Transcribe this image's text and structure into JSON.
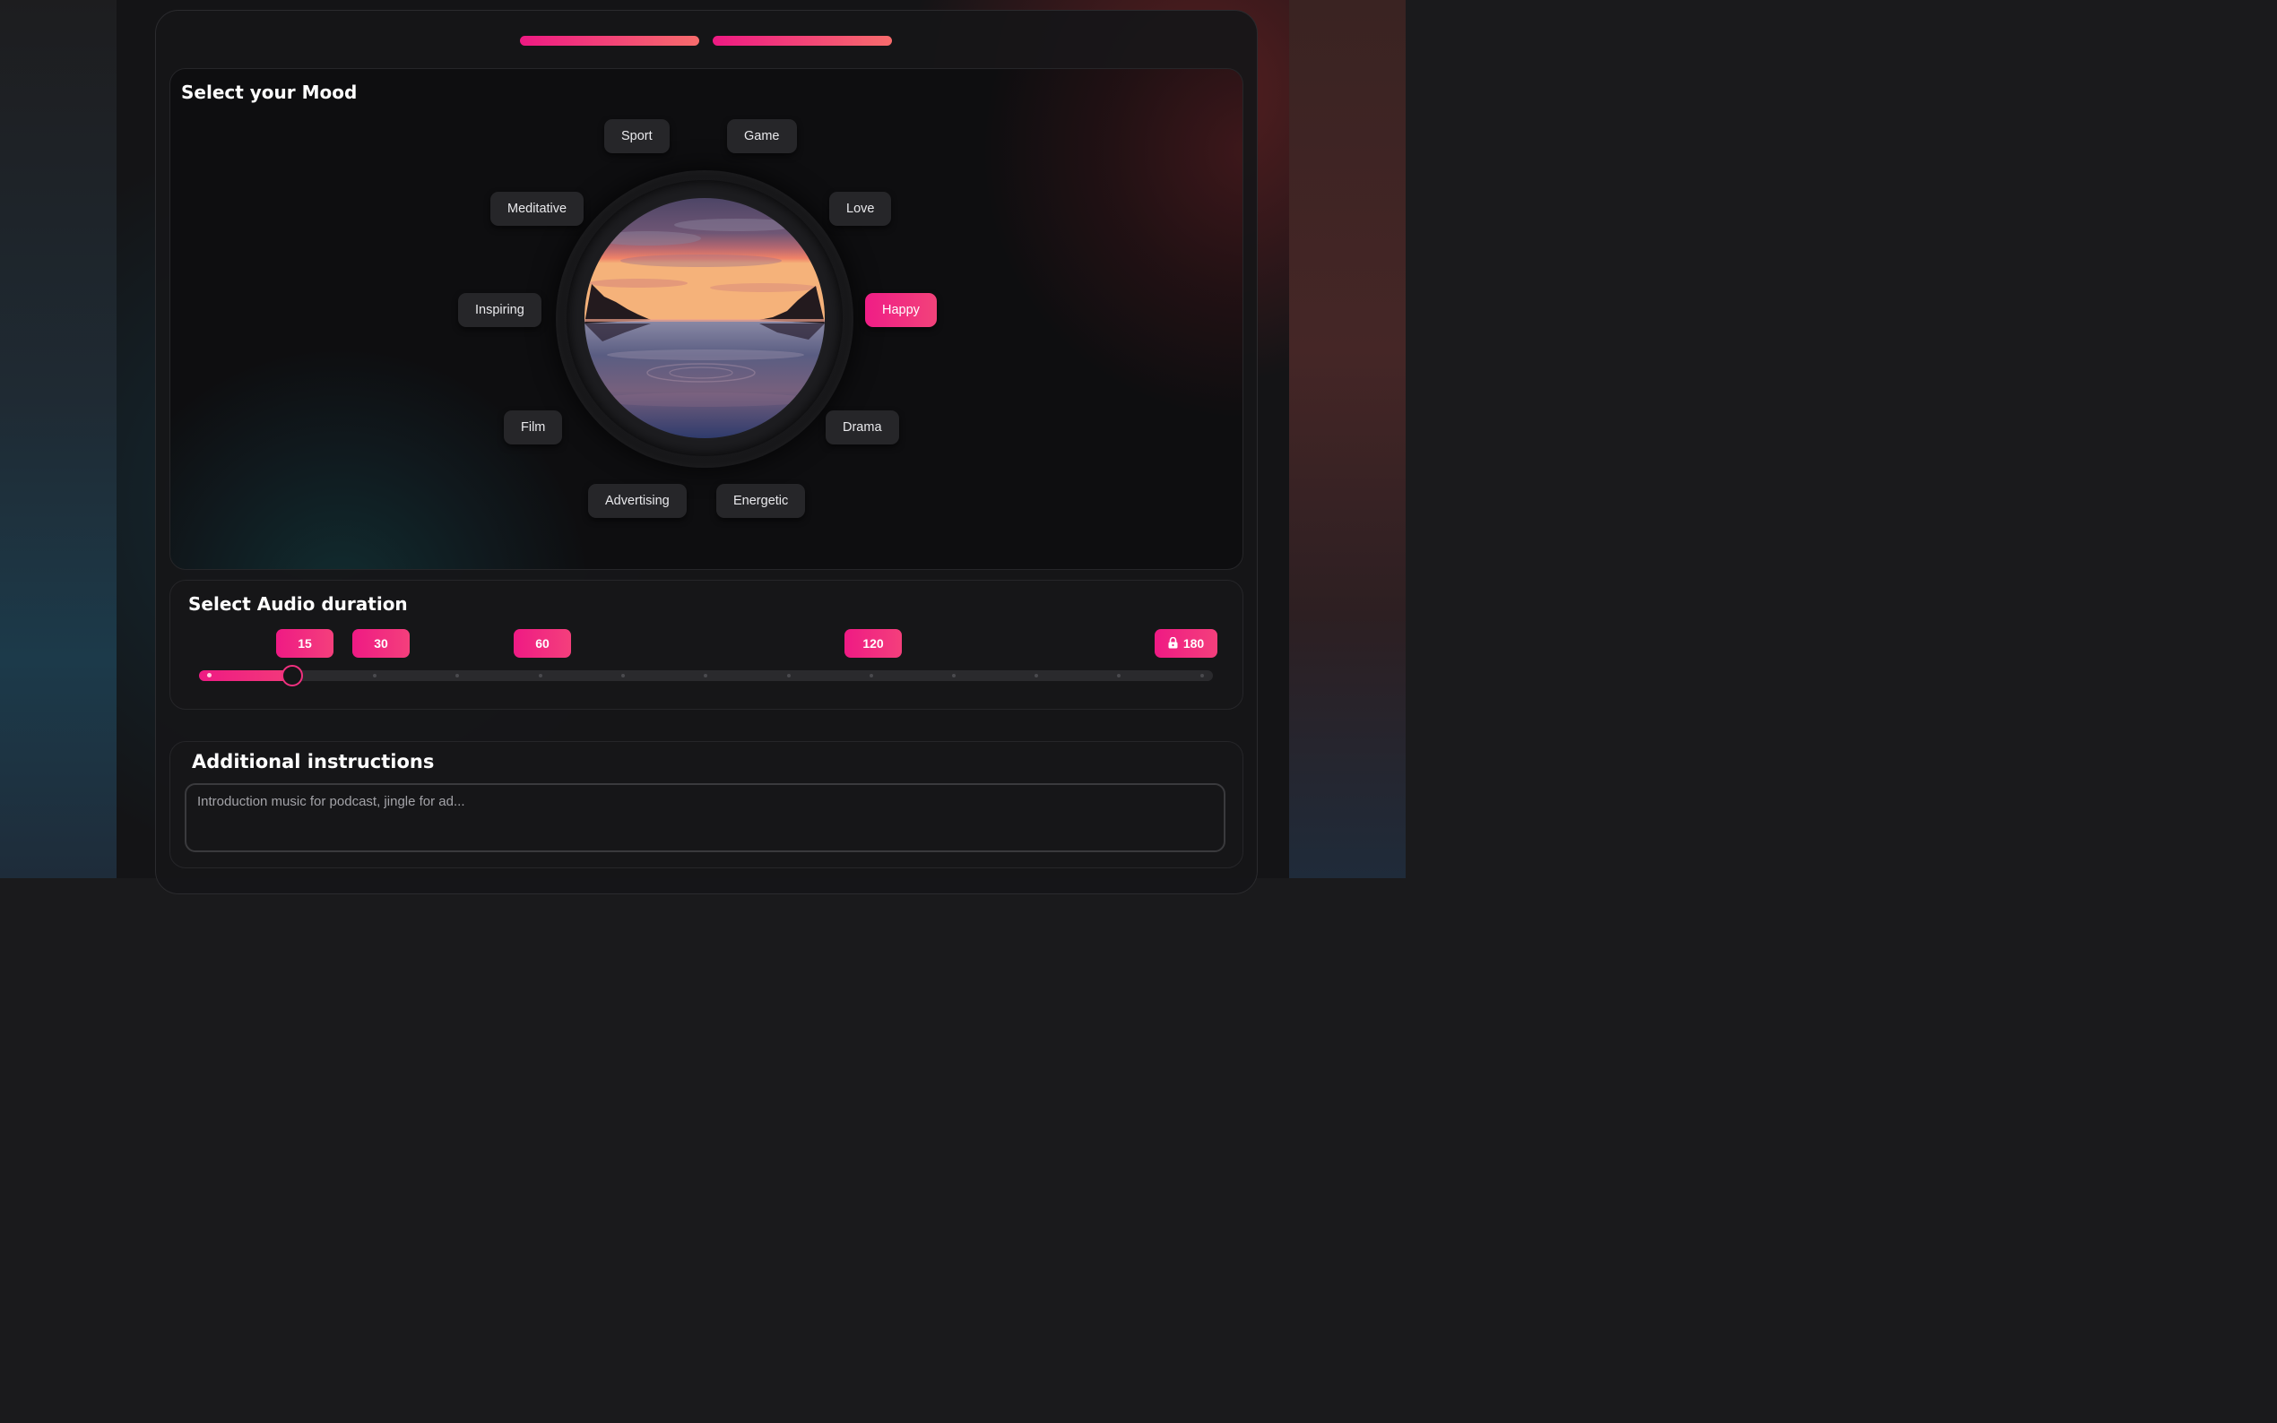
{
  "progress_steps": [
    {
      "status": "complete",
      "color": "#ee1a83"
    },
    {
      "status": "complete",
      "color": "#f76c6c"
    }
  ],
  "mood": {
    "title": "Select your Mood",
    "selected": "Happy",
    "options": [
      "Sport",
      "Game",
      "Meditative",
      "Love",
      "Inspiring",
      "Happy",
      "Film",
      "Drama",
      "Advertising",
      "Energetic"
    ]
  },
  "duration": {
    "title": "Select Audio duration",
    "markers": [
      "15",
      "30",
      "60",
      "120",
      "180"
    ],
    "locked": [
      "180"
    ],
    "lock_icon": "lock-icon",
    "selected_value": "15"
  },
  "instructions": {
    "title": "Additional instructions",
    "placeholder": "Introduction music for podcast, jingle for ad...",
    "value": ""
  },
  "colors": {
    "accent_start": "#ee1a83",
    "accent_end": "#f76c6c",
    "button_bg": "#262629"
  }
}
